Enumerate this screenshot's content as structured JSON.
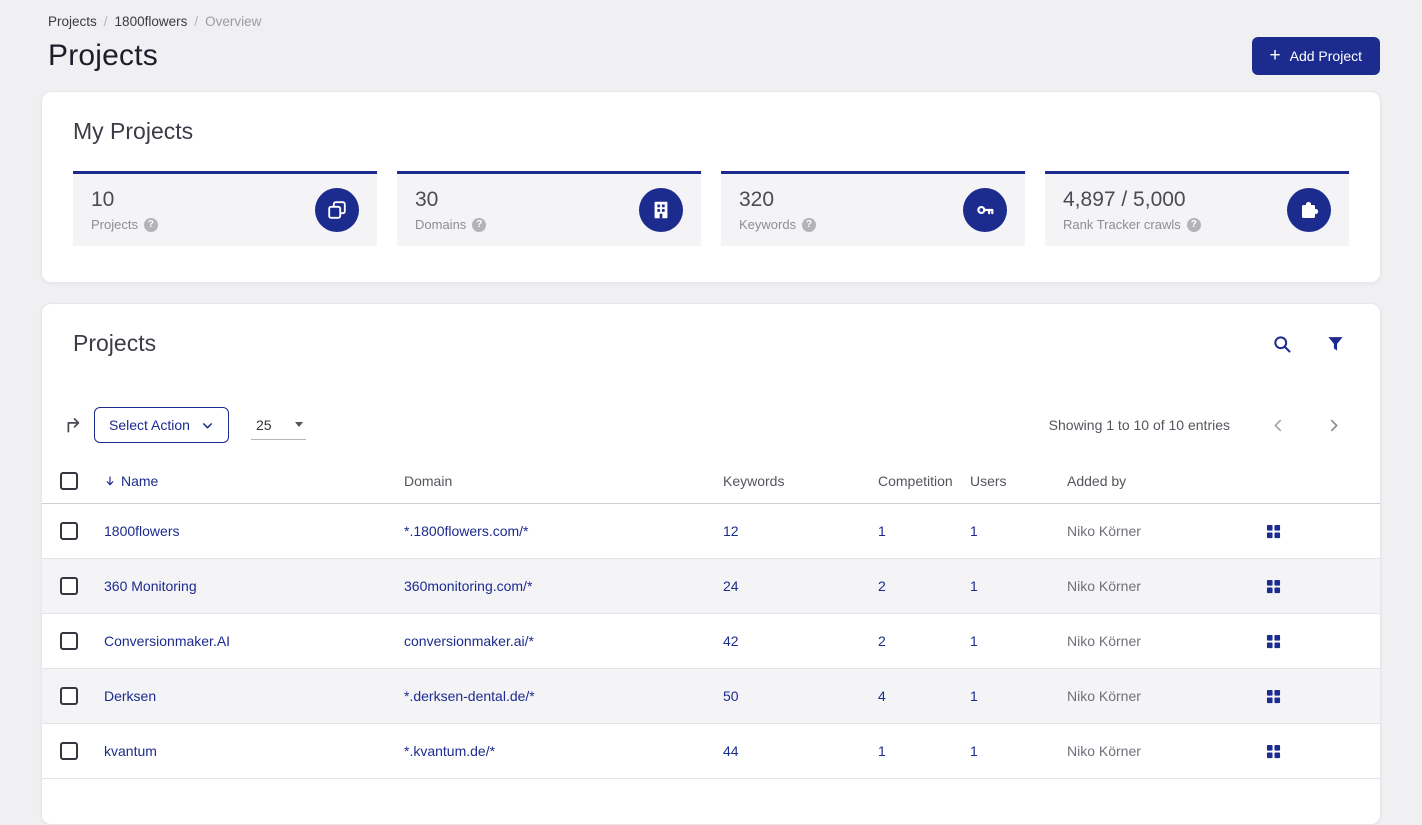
{
  "colors": {
    "navy": "#1c2b8e",
    "page_bg": "#f0f0f2"
  },
  "icons": {
    "plus": "+",
    "help": "?"
  },
  "breadcrumb": {
    "separator": "/",
    "items": [
      "Projects",
      "1800flowers",
      "Overview"
    ]
  },
  "header": {
    "title": "Projects",
    "add_button_label": "Add Project"
  },
  "my_projects": {
    "title": "My Projects",
    "stats": [
      {
        "value": "10",
        "label": "Projects",
        "icon": "projects-icon"
      },
      {
        "value": "30",
        "label": "Domains",
        "icon": "domains-icon"
      },
      {
        "value": "320",
        "label": "Keywords",
        "icon": "keywords-icon"
      },
      {
        "value": "4,897 / 5,000",
        "label": "Rank Tracker crawls",
        "icon": "puzzle-icon"
      }
    ]
  },
  "projects_panel": {
    "title": "Projects",
    "toolbar": {
      "select_action_label": "Select Action",
      "page_size": "25",
      "showing_text": "Showing 1 to 10 of 10 entries"
    },
    "table": {
      "headers": {
        "name": "Name",
        "domain": "Domain",
        "keywords": "Keywords",
        "competition": "Competition",
        "users": "Users",
        "added_by": "Added by"
      },
      "rows": [
        {
          "name": "1800flowers",
          "domain": "*.1800flowers.com/*",
          "keywords": "12",
          "competition": "1",
          "users": "1",
          "added_by": "Niko Körner"
        },
        {
          "name": "360 Monitoring",
          "domain": "360monitoring.com/*",
          "keywords": "24",
          "competition": "2",
          "users": "1",
          "added_by": "Niko Körner"
        },
        {
          "name": "Conversionmaker.AI",
          "domain": "conversionmaker.ai/*",
          "keywords": "42",
          "competition": "2",
          "users": "1",
          "added_by": "Niko Körner"
        },
        {
          "name": "Derksen",
          "domain": "*.derksen-dental.de/*",
          "keywords": "50",
          "competition": "4",
          "users": "1",
          "added_by": "Niko Körner"
        },
        {
          "name": "kvantum",
          "domain": "*.kvantum.de/*",
          "keywords": "44",
          "competition": "1",
          "users": "1",
          "added_by": "Niko Körner"
        }
      ]
    }
  }
}
